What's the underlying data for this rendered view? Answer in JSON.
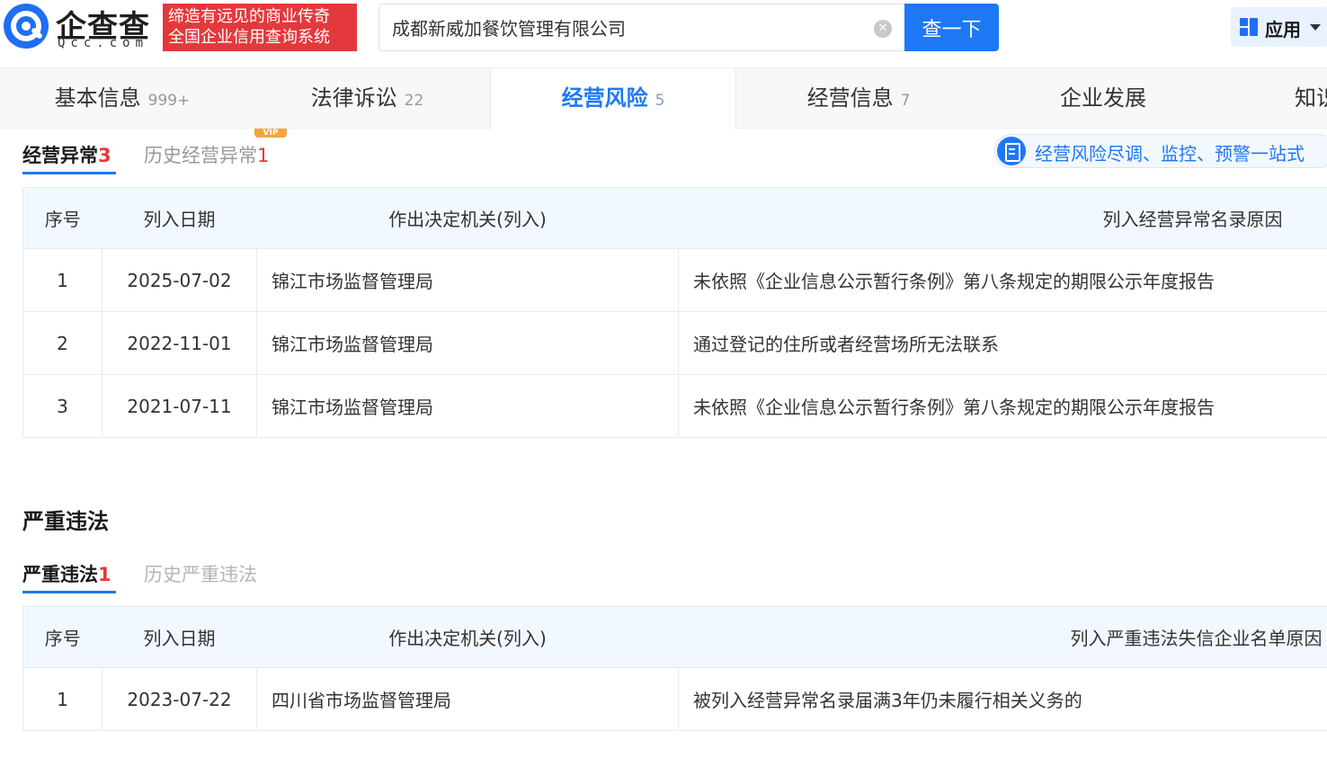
{
  "header": {
    "logo_cn": "企查查",
    "logo_en": "Qcc.com",
    "slogan_line1": "缔造有远见的商业传奇",
    "slogan_line2": "全国企业信用查询系统",
    "search_value": "成都新威加餐饮管理有限公司",
    "search_button": "查一下",
    "apps_label": "应用"
  },
  "tabs": [
    {
      "label": "基本信息",
      "count": "999+"
    },
    {
      "label": "法律诉讼",
      "count": "22"
    },
    {
      "label": "经营风险",
      "count": "5"
    },
    {
      "label": "经营信息",
      "count": "7"
    },
    {
      "label": "企业发展",
      "count": ""
    },
    {
      "label": "知识",
      "count": ""
    }
  ],
  "abnormal": {
    "subtab_active": "经营异常",
    "subtab_active_count": "3",
    "subtab_history": "历史经营异常",
    "subtab_history_count": "1",
    "vip_badge": "VIP",
    "promo_text": "经营风险尽调、监控、预警一站式",
    "columns": [
      "序号",
      "列入日期",
      "作出决定机关(列入)",
      "列入经营异常名录原因"
    ],
    "rows": [
      [
        "1",
        "2025-07-02",
        "锦江市场监督管理局",
        "未依照《企业信息公示暂行条例》第八条规定的期限公示年度报告"
      ],
      [
        "2",
        "2022-11-01",
        "锦江市场监督管理局",
        "通过登记的住所或者经营场所无法联系"
      ],
      [
        "3",
        "2021-07-11",
        "锦江市场监督管理局",
        "未依照《企业信息公示暂行条例》第八条规定的期限公示年度报告"
      ]
    ]
  },
  "violation": {
    "section_title": "严重违法",
    "subtab_active": "严重违法",
    "subtab_active_count": "1",
    "subtab_history": "历史严重违法",
    "columns": [
      "序号",
      "列入日期",
      "作出决定机关(列入)",
      "列入严重违法失信企业名单原因"
    ],
    "rows": [
      [
        "1",
        "2023-07-22",
        "四川省市场监督管理局",
        "被列入经营异常名录届满3年仍未履行相关义务的"
      ]
    ]
  },
  "colors": {
    "brand_blue": "#1e78f5",
    "slogan_red": "#e4393c",
    "count_red": "#e4393c",
    "table_header_bg": "#f2f8ff"
  }
}
